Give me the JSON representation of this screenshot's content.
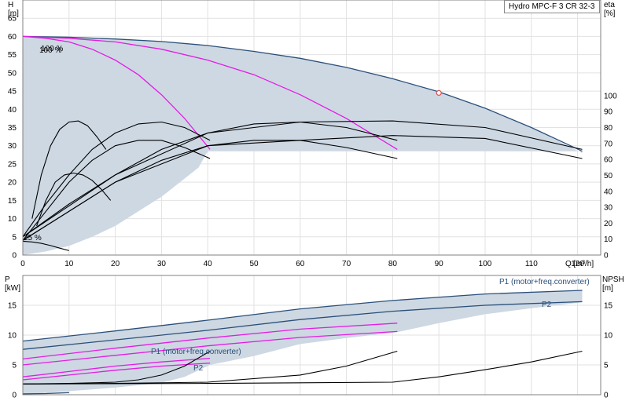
{
  "title": "Hydro MPC-F 3 CR 32-3",
  "colors": {
    "area": "#cdd8e3",
    "envelope": "#2b4f7a",
    "magenta": "#e31de3",
    "black": "#000000",
    "grid": "#e2e2e2",
    "duty_point": "#e05050"
  },
  "chart_data": [
    {
      "type": "line",
      "name": "head",
      "xlabel": "Q [m³/h]",
      "ylabel": "H [m]",
      "y2label": "eta [%]",
      "xlim": [
        0,
        125
      ],
      "ylim": [
        0,
        70
      ],
      "y2lim": [
        0,
        160
      ],
      "xticks": [
        0,
        10,
        20,
        30,
        40,
        50,
        60,
        70,
        80,
        90,
        100,
        110,
        120
      ],
      "yticks": [
        0,
        5,
        10,
        15,
        20,
        25,
        30,
        35,
        40,
        45,
        50,
        55,
        60,
        65
      ],
      "y2ticks": [
        0,
        10,
        20,
        30,
        40,
        50,
        60,
        70,
        80,
        90,
        100
      ],
      "annotations": [
        "100 %",
        "25 %"
      ],
      "duty_point": {
        "x": 90,
        "y": 44.5
      },
      "area": {
        "x": [
          0,
          10,
          20,
          30,
          40,
          50,
          60,
          70,
          80,
          90,
          100,
          110,
          121,
          121,
          110,
          100,
          80,
          60,
          40,
          38,
          35,
          30,
          25,
          20,
          15,
          10,
          5,
          0
        ],
        "y": [
          60,
          59.8,
          59.3,
          58.6,
          57.5,
          55.9,
          54,
          51.5,
          48.4,
          44.8,
          40.3,
          35,
          28,
          28.5,
          28.5,
          28.5,
          28.5,
          28.5,
          28.5,
          24,
          21,
          16,
          12,
          8,
          5,
          2.5,
          1,
          0
        ]
      },
      "series": [
        {
          "color": "envelope",
          "x": [
            0,
            10,
            20,
            30,
            40,
            50,
            60,
            70,
            80,
            90,
            100,
            110,
            121
          ],
          "y": [
            60,
            59.8,
            59.3,
            58.6,
            57.5,
            55.9,
            54,
            51.5,
            48.4,
            44.8,
            40.3,
            35,
            28.5
          ]
        },
        {
          "color": "magenta",
          "x": [
            0,
            10,
            20,
            30,
            40,
            50,
            60,
            70,
            81
          ],
          "y": [
            60,
            59.5,
            58.5,
            56.5,
            53.5,
            49.5,
            44,
            37.5,
            29
          ]
        },
        {
          "color": "magenta",
          "x": [
            0,
            5,
            10,
            15,
            20,
            25,
            30,
            35,
            40.5
          ],
          "y": [
            60,
            59.5,
            58.5,
            56.5,
            53.5,
            49.5,
            44,
            37.5,
            29
          ]
        },
        {
          "color": "black",
          "x": [
            0,
            2,
            4,
            6,
            8,
            10
          ],
          "y": [
            3.8,
            3.6,
            3.2,
            2.6,
            1.9,
            1.2
          ]
        },
        {
          "color": "black",
          "x": [
            2,
            4,
            6,
            8,
            10,
            12,
            14,
            16,
            18
          ],
          "y": [
            10,
            22,
            30,
            34.5,
            36.5,
            36.8,
            35.5,
            32.5,
            29
          ]
        },
        {
          "color": "black",
          "x": [
            3,
            5,
            7,
            9,
            11,
            13,
            15,
            17,
            19
          ],
          "y": [
            8,
            15,
            20,
            22,
            22.5,
            22,
            20.5,
            18,
            15
          ]
        },
        {
          "color": "black",
          "x": [
            0,
            5,
            10,
            15,
            20,
            25,
            30,
            35,
            40.5
          ],
          "y": [
            4,
            12,
            20,
            26,
            30,
            31.5,
            31.5,
            29.5,
            26.5
          ]
        },
        {
          "color": "black",
          "x": [
            0,
            5,
            10,
            15,
            20,
            25,
            30,
            35,
            40.5
          ],
          "y": [
            5,
            14,
            22,
            29,
            33.5,
            36,
            36.5,
            35,
            31.5
          ]
        },
        {
          "color": "black",
          "x": [
            0,
            10,
            20,
            30,
            40,
            50,
            60,
            70,
            81
          ],
          "y": [
            4,
            12,
            20,
            26,
            30,
            31.5,
            31.5,
            29.5,
            26.5
          ]
        },
        {
          "color": "black",
          "x": [
            0,
            10,
            20,
            30,
            40,
            50,
            60,
            70,
            81
          ],
          "y": [
            5,
            14,
            22,
            29,
            33.5,
            36,
            36.5,
            35,
            31.5
          ]
        },
        {
          "color": "black",
          "x": [
            0,
            20,
            40,
            60,
            80,
            100,
            121
          ],
          "y": [
            4,
            20,
            30,
            31.5,
            32.8,
            32,
            26.5
          ]
        },
        {
          "color": "black",
          "x": [
            0,
            20,
            40,
            60,
            80,
            100,
            121
          ],
          "y": [
            5,
            22,
            33.5,
            36.5,
            36.8,
            35,
            29
          ]
        }
      ]
    },
    {
      "type": "line",
      "name": "power",
      "ylabel": "P [kW]",
      "y2label": "NPSH [m]",
      "xlim": [
        0,
        125
      ],
      "ylim": [
        0,
        20
      ],
      "y2lim": [
        0,
        20
      ],
      "yticks": [
        0,
        5,
        10,
        15
      ],
      "y2ticks": [
        0,
        5,
        10,
        15
      ],
      "annotations": [
        "P1 (motor+freq.converter)",
        "P2",
        "P1 (motor+freq.converter)",
        "P2"
      ],
      "area": {
        "x": [
          0,
          20,
          40,
          60,
          80,
          100,
          121,
          121,
          110,
          100,
          90,
          81,
          70,
          60,
          50,
          40.5,
          35,
          30,
          20,
          10,
          0
        ],
        "y": [
          9,
          10.7,
          12.5,
          14.4,
          15.8,
          16.9,
          17.5,
          15.5,
          14.5,
          13.5,
          12,
          10.5,
          9.5,
          8.5,
          6.5,
          5,
          3,
          2,
          1.2,
          0.6,
          0
        ]
      },
      "series": [
        {
          "color": "envelope",
          "x": [
            0,
            20,
            40,
            60,
            80,
            100,
            121
          ],
          "y": [
            9,
            10.7,
            12.5,
            14.4,
            15.8,
            16.9,
            17.5
          ]
        },
        {
          "color": "envelope",
          "x": [
            0,
            20,
            40,
            60,
            80,
            100,
            121
          ],
          "y": [
            7.6,
            9.2,
            10.8,
            12.6,
            14,
            15,
            15.6
          ]
        },
        {
          "color": "magenta",
          "x": [
            0,
            20,
            40,
            60,
            81
          ],
          "y": [
            6,
            7.8,
            9.5,
            11,
            12
          ]
        },
        {
          "color": "magenta",
          "x": [
            0,
            20,
            40,
            60,
            81
          ],
          "y": [
            5,
            6.6,
            8.2,
            9.6,
            10.6
          ]
        },
        {
          "color": "magenta",
          "x": [
            0,
            10,
            20,
            30,
            40.5
          ],
          "y": [
            3,
            3.9,
            4.8,
            5.5,
            6.1
          ]
        },
        {
          "color": "magenta",
          "x": [
            0,
            10,
            20,
            30,
            40.5
          ],
          "y": [
            2.5,
            3.3,
            4.1,
            4.8,
            5.3
          ]
        },
        {
          "color": "black",
          "x": [
            0,
            10,
            20,
            25,
            30,
            35,
            40.5
          ],
          "y": [
            1.8,
            1.9,
            2.1,
            2.5,
            3.3,
            4.8,
            7.3
          ]
        },
        {
          "color": "black",
          "x": [
            0,
            20,
            40,
            60,
            70,
            81
          ],
          "y": [
            1.8,
            1.9,
            2.1,
            3.3,
            4.8,
            7.3
          ]
        },
        {
          "color": "black",
          "x": [
            0,
            40,
            80,
            90,
            100,
            110,
            121
          ],
          "y": [
            1.8,
            1.9,
            2.1,
            3,
            4.2,
            5.5,
            7.3
          ]
        },
        {
          "color": "envelope",
          "x": [
            0,
            5,
            10
          ],
          "y": [
            0.15,
            0.2,
            0.35
          ]
        }
      ]
    }
  ]
}
